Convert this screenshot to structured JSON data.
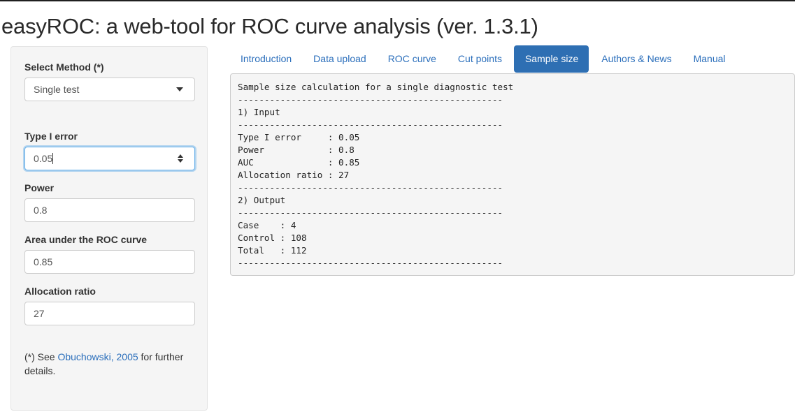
{
  "page": {
    "title": "easyROC: a web-tool for ROC curve analysis (ver. 1.3.1)"
  },
  "sidebar": {
    "method_label": "Select Method (*)",
    "method_value": "Single test",
    "type1_label": "Type I error",
    "type1_value": "0.05",
    "power_label": "Power",
    "power_value": "0.8",
    "auc_label": "Area under the ROC curve",
    "auc_value": "0.85",
    "allocation_label": "Allocation ratio",
    "allocation_value": "27",
    "footnote_prefix": "(*) See ",
    "footnote_link": "Obuchowski, 2005",
    "footnote_suffix": " for further details."
  },
  "tabs": [
    {
      "label": "Introduction",
      "active": false
    },
    {
      "label": "Data upload",
      "active": false
    },
    {
      "label": "ROC curve",
      "active": false
    },
    {
      "label": "Cut points",
      "active": false
    },
    {
      "label": "Sample size",
      "active": true
    },
    {
      "label": "Authors & News",
      "active": false
    },
    {
      "label": "Manual",
      "active": false
    }
  ],
  "output": {
    "lines": [
      "Sample size calculation for a single diagnostic test",
      "--------------------------------------------------",
      "1) Input",
      "--------------------------------------------------",
      "Type I error     : 0.05",
      "Power            : 0.8",
      "AUC              : 0.85",
      "Allocation ratio : 27",
      "--------------------------------------------------",
      "2) Output",
      "--------------------------------------------------",
      "Case    : 4",
      "Control : 108",
      "Total   : 112",
      "--------------------------------------------------"
    ]
  },
  "colors": {
    "accent": "#2e6fb3",
    "link": "#2a6ebb",
    "panel_bg": "#f5f5f5"
  }
}
